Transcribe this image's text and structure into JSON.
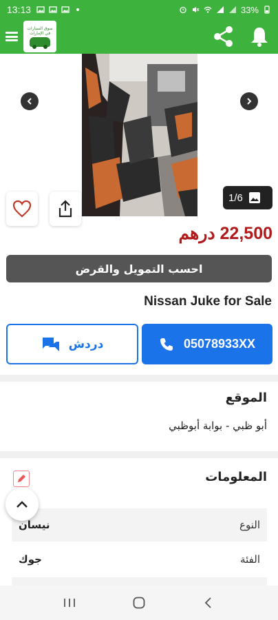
{
  "status_bar": {
    "time": "13:13",
    "battery": "33%"
  },
  "app_bar": {
    "logo_text": "سوق السيارات في الإمارات"
  },
  "gallery": {
    "counter": "1/6"
  },
  "listing": {
    "price": "22,500 درهم",
    "finance_label": "احسب التمويل والقرض",
    "title": "Nissan Juke for Sale"
  },
  "contact": {
    "chat_label": "دردش",
    "phone": "05078933XX"
  },
  "location": {
    "heading": "الموقع",
    "value": "أبو ظبي - بوابة أبوظبي"
  },
  "info": {
    "heading": "المعلومات",
    "rows": [
      {
        "key": "النوع",
        "value": "نيسان"
      },
      {
        "key": "الفئة",
        "value": "جوك"
      }
    ]
  },
  "colors": {
    "brand_green": "#3db23d",
    "price_red": "#b11a1a",
    "action_blue": "#1a73e8"
  }
}
